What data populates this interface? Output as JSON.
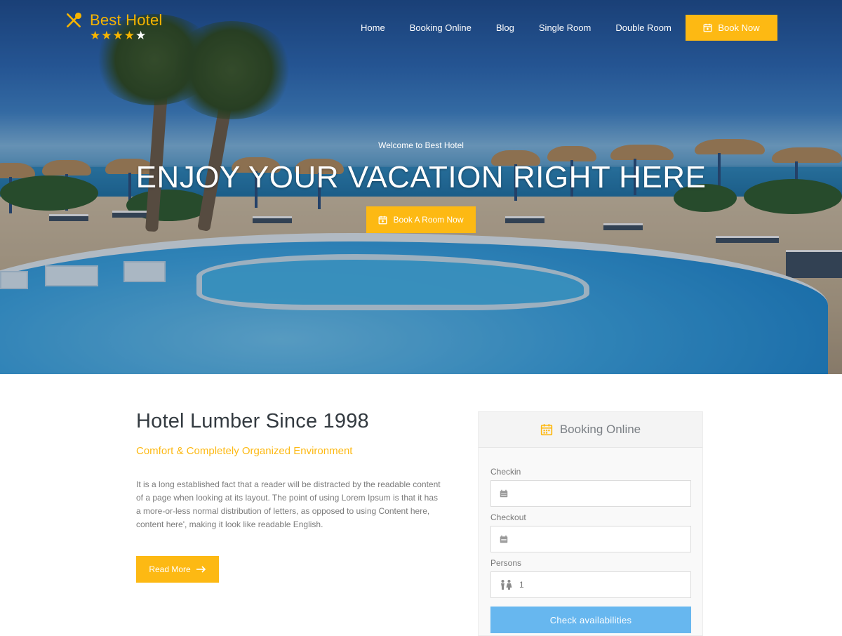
{
  "brand": {
    "name": "Best Hotel",
    "rating": 4,
    "rating_max": 5,
    "accent_color": "#fdb913"
  },
  "nav": {
    "items": [
      {
        "label": "Home"
      },
      {
        "label": "Booking Online"
      },
      {
        "label": "Blog"
      },
      {
        "label": "Single Room"
      },
      {
        "label": "Double Room"
      }
    ],
    "cta_label": "Book Now",
    "cta_icon": "calendar-icon"
  },
  "hero": {
    "welcome": "Welcome to Best Hotel",
    "headline": "ENJOY YOUR VACATION RIGHT HERE",
    "button_label": "Book A Room Now",
    "button_icon": "calendar-icon"
  },
  "about": {
    "title": "Hotel Lumber Since 1998",
    "subtitle": "Comfort & Completely Organized Environment",
    "text": "It is a long established fact that a reader will be distracted by the readable content of a page when looking at its layout. The point of using Lorem Ipsum is that it has a more-or-less normal distribution of letters, as opposed to using Content here, content here', making it look like readable English.",
    "button_label": "Read More",
    "button_icon": "arrow-right-icon"
  },
  "booking": {
    "title": "Booking Online",
    "title_icon": "calendar-icon",
    "checkin_label": "Checkin",
    "checkin_value": "",
    "checkout_label": "Checkout",
    "checkout_value": "",
    "persons_label": "Persons",
    "persons_value": "1",
    "submit_label": "Check availabilities",
    "submit_color": "#67b7ef"
  }
}
